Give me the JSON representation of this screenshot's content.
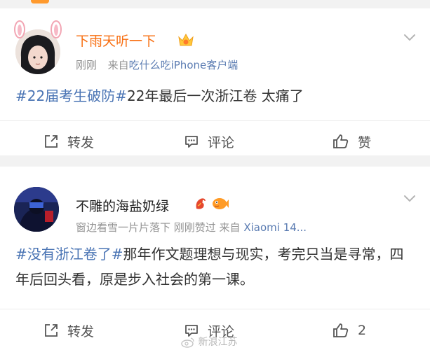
{
  "posts": [
    {
      "username": "下雨天听一下",
      "time": "刚刚",
      "source_prefix": "来自",
      "source_app": "吃什么吃iPhone客户端",
      "tag": "#22届考生破防#",
      "text": "22年最后一次浙江卷 太痛了",
      "actions": {
        "repost": "转发",
        "comment": "评论",
        "like": "赞"
      }
    },
    {
      "username": "不雕的海盐奶绿",
      "meta_text": "窗边看雪一片片落下 刚刚赞过 来自",
      "source_app": "Xiaomi 14...",
      "tag": "#没有浙江卷了#",
      "text": "那年作文题理想与现实，考完只当是寻常，四年后回头看，原是步入社会的第一课。",
      "actions": {
        "repost": "转发",
        "comment": "评论",
        "like_count": "2"
      }
    }
  ],
  "watermark": "新浪江苏",
  "colors": {
    "link": "#4a74b4",
    "vip_name": "#f86f12",
    "meta": "#939393"
  },
  "icons": [
    "bunny-ears",
    "crown-badge",
    "chevron-down-icon",
    "repost-icon",
    "comment-icon",
    "like-icon",
    "dragon-emoji",
    "fish-emoji",
    "weibo-logo-icon"
  ]
}
